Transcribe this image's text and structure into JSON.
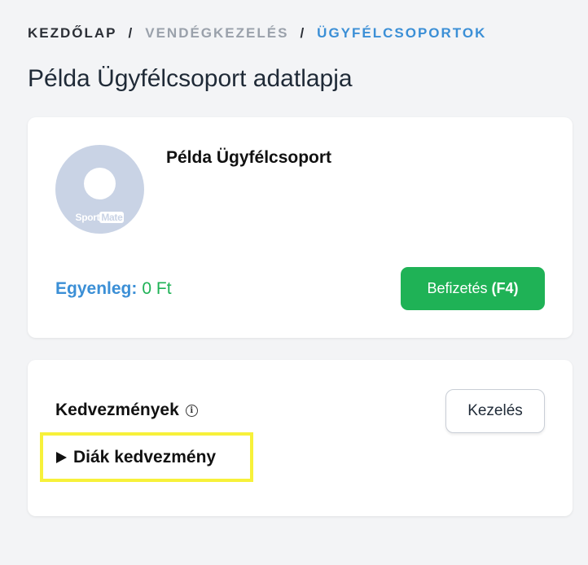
{
  "breadcrumb": {
    "home": "KEZDŐLAP",
    "separator": "/",
    "section": "VENDÉGKEZELÉS",
    "current": "ÜGYFÉLCSOPORTOK"
  },
  "page": {
    "title": "Példa Ügyfélcsoport adatlapja"
  },
  "profile": {
    "avatar_logo_sport": "Sport",
    "avatar_logo_mate": "Mate",
    "name": "Példa Ügyfélcsoport",
    "balance_label": "Egyenleg:",
    "balance_value": "0 Ft",
    "pay_button_label": "Befizetés",
    "pay_button_hotkey": "(F4)"
  },
  "discounts": {
    "title": "Kedvezmények",
    "info_glyph": "i",
    "manage_button_label": "Kezelés",
    "items": [
      {
        "label": "Diák kedvezmény"
      }
    ]
  },
  "colors": {
    "accent_blue": "#3b8fd6",
    "success_green": "#1fb256",
    "highlight_yellow": "#f7f13a"
  }
}
